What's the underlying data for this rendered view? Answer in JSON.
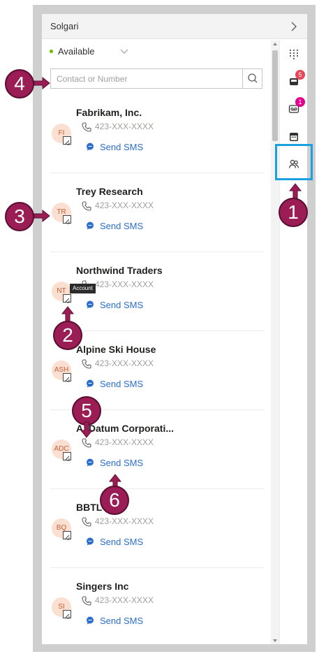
{
  "titlebar": {
    "title": "Solgari"
  },
  "presence": {
    "status": "Available",
    "color": "#6bb700"
  },
  "search": {
    "placeholder": "Contact or Number"
  },
  "contacts": [
    {
      "name": "Fabrikam, Inc.",
      "initials": "FI",
      "phone": "423-XXX-XXXX",
      "action": "Send SMS"
    },
    {
      "name": "Trey Research",
      "initials": "TR",
      "phone": "423-XXX-XXXX",
      "action": "Send SMS"
    },
    {
      "name": "Northwind Traders",
      "initials": "NT",
      "phone": "423-XXX-XXXX",
      "action": "Send SMS"
    },
    {
      "name": "Alpine Ski House",
      "initials": "ASH",
      "phone": "423-XXX-XXXX",
      "action": "Send SMS"
    },
    {
      "name": "A. Datum Corporati...",
      "initials": "ADC",
      "phone": "423-XXX-XXXX",
      "action": "Send SMS"
    },
    {
      "name": "BBTL",
      "initials": "BQ",
      "phone": "423-XXX-XXXX",
      "action": "Send SMS"
    },
    {
      "name": "Singers Inc",
      "initials": "SI",
      "phone": "423-XXX-XXXX",
      "action": "Send SMS"
    }
  ],
  "rail": {
    "items": [
      {
        "icon": "dialpad-icon"
      },
      {
        "icon": "inbox-icon",
        "count": "5",
        "count_color": "#e74856"
      },
      {
        "icon": "voicemail-icon",
        "count": "1",
        "count_color": "#e3008c"
      },
      {
        "icon": "calendar-icon"
      },
      {
        "icon": "contacts-icon"
      }
    ]
  },
  "tooltip": {
    "text": "Account"
  },
  "callouts": [
    "1",
    "2",
    "3",
    "4",
    "5",
    "6"
  ],
  "colors": {
    "accent": "#2b6ecb",
    "highlight": "#1ba1e2",
    "callout": "#9b1d55"
  }
}
